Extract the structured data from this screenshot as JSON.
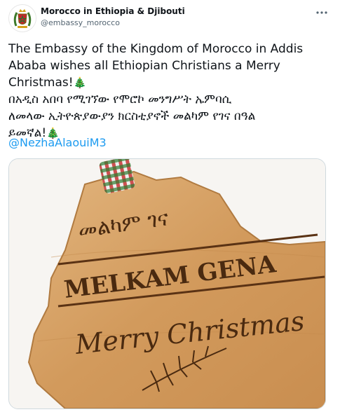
{
  "tweet": {
    "author": {
      "display_name": "Morocco in Ethiopia & Djibouti",
      "handle": "@embassy_morocco",
      "avatar_icon": "moroccan-coat-of-arms"
    },
    "more_icon": "more-options-icon",
    "text_lines": {
      "english": "The Embassy of the Kingdom of Morocco in Addis Ababa wishes all Ethiopian Christians a Merry Christmas!",
      "amharic_1": "በአዲስ አበባ የሚገኘው የሞሮኮ መንግሥት ኤምባሲ",
      "amharic_2": "ለመላው ኢትዮጵያውያን ክርስቲያኖች መልካም የገና በዓል",
      "amharic_3": "ይመኛል!"
    },
    "emoji": "🎄",
    "mention": "@NezhaAlaouiM3",
    "image": {
      "engraved_geez": "መልካም ገና",
      "engraved_title": "MELKAM GENA",
      "engraved_script": "Merry Christmas"
    }
  },
  "colors": {
    "accent": "#1d9bf0",
    "text": "#0f1419",
    "secondary": "#536471",
    "wood": "#d9a469"
  }
}
